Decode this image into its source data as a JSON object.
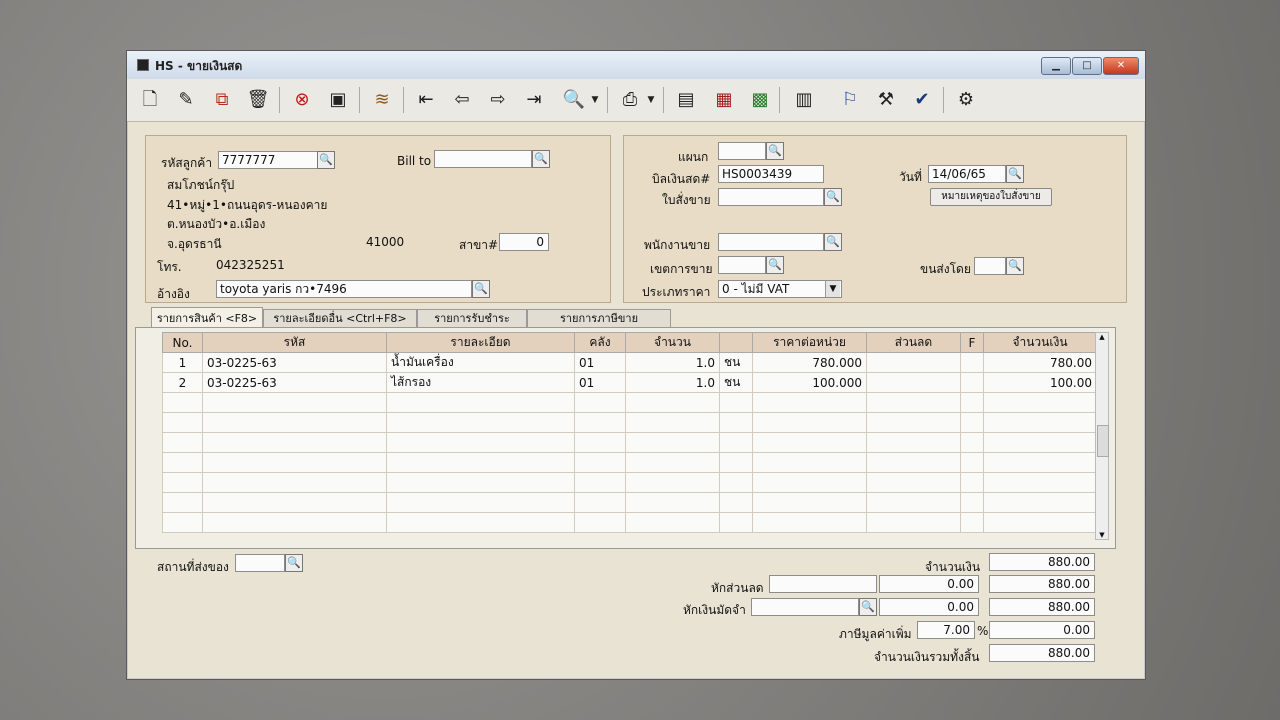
{
  "window": {
    "title": "HS - ขายเงินสด"
  },
  "toolbar": {
    "icons": [
      "new-icon",
      "edit-icon",
      "copy-icon",
      "delete-icon",
      "cancel-icon",
      "save-icon",
      "books-icon",
      "first-icon",
      "prev-icon",
      "next-icon",
      "last-icon",
      "find-icon",
      "print-icon",
      "calc-icon",
      "document-icon",
      "export-icon",
      "report-icon",
      "ok-stamp-icon",
      "tools-icon",
      "ok-icon",
      "manager-icon"
    ]
  },
  "customer": {
    "code_label": "รหัสลูกค้า",
    "code": "7777777",
    "bill_to_label": "Bill to",
    "bill_to": "",
    "name": "สมโภชน์กรุ๊ป",
    "address1": "41•หมู่•1•ถนนอุดร-หนองคาย",
    "address2": "ต.หนองบัว•อ.เมือง",
    "province": "จ.อุดรธานี",
    "postcode": "41000",
    "branch_label": "สาขา#",
    "branch": "0",
    "phone_label": "โทร.",
    "phone": "042325251",
    "ref_label": "อ้างอิง",
    "ref": "toyota yaris กว•7496"
  },
  "doc": {
    "dept_label": "แผนก",
    "dept": "",
    "bill_label": "บิลเงินสด#",
    "bill_no": "HS0003439",
    "date_label": "วันที่",
    "date": "14/06/65",
    "order_label": "ใบสั่งขาย",
    "order": "",
    "note_button": "หมายเหตุของใบสั่งขาย",
    "sales_label": "พนักงานขาย",
    "sales": "",
    "zone_label": "เขตการขาย",
    "zone": "",
    "ship_by_label": "ขนส่งโดย",
    "ship_by": "",
    "price_type_label": "ประเภทราคา",
    "price_type": "0 - ไม่มี VAT"
  },
  "tabs": [
    {
      "label": "รายการสินค้า <F8>",
      "active": true
    },
    {
      "label": "รายละเอียดอื่น <Ctrl+F8>",
      "active": false
    },
    {
      "label": "รายการรับชำระ <F7>",
      "active": false
    },
    {
      "label": "รายการภาษีขาย <Ctrl+F7>",
      "active": false
    }
  ],
  "table": {
    "headers": [
      "No.",
      "รหัส",
      "รายละเอียด",
      "คลัง",
      "จำนวน",
      "",
      "ราคาต่อหน่วย",
      "ส่วนลด",
      "F",
      "จำนวนเงิน"
    ],
    "rows": [
      [
        "1",
        "03-0225-63",
        "น้ำมันเครื่อง",
        "01",
        "1.0",
        "ชน",
        "780.000",
        "",
        "",
        "780.00"
      ],
      [
        "2",
        "03-0225-63",
        "ไส้กรอง",
        "01",
        "1.0",
        "ชน",
        "100.000",
        "",
        "",
        "100.00"
      ]
    ],
    "empty_rows": 7
  },
  "footer": {
    "ship_place_label": "สถานที่ส่งของ",
    "ship_place": "",
    "amount_label": "จำนวนเงิน",
    "amount": "880.00",
    "discount_label": "หักส่วนลด",
    "discount_code": "",
    "discount": "0.00",
    "after_discount": "880.00",
    "deposit_label": "หักเงินมัดจำ",
    "deposit_code": "",
    "deposit": "0.00",
    "after_deposit": "880.00",
    "vat_label": "ภาษีมูลค่าเพิ่ม",
    "vat_rate": "7.00",
    "vat_pct": "%",
    "vat": "0.00",
    "total_label": "จำนวนเงินรวมทั้งสิ้น",
    "total": "880.00"
  }
}
